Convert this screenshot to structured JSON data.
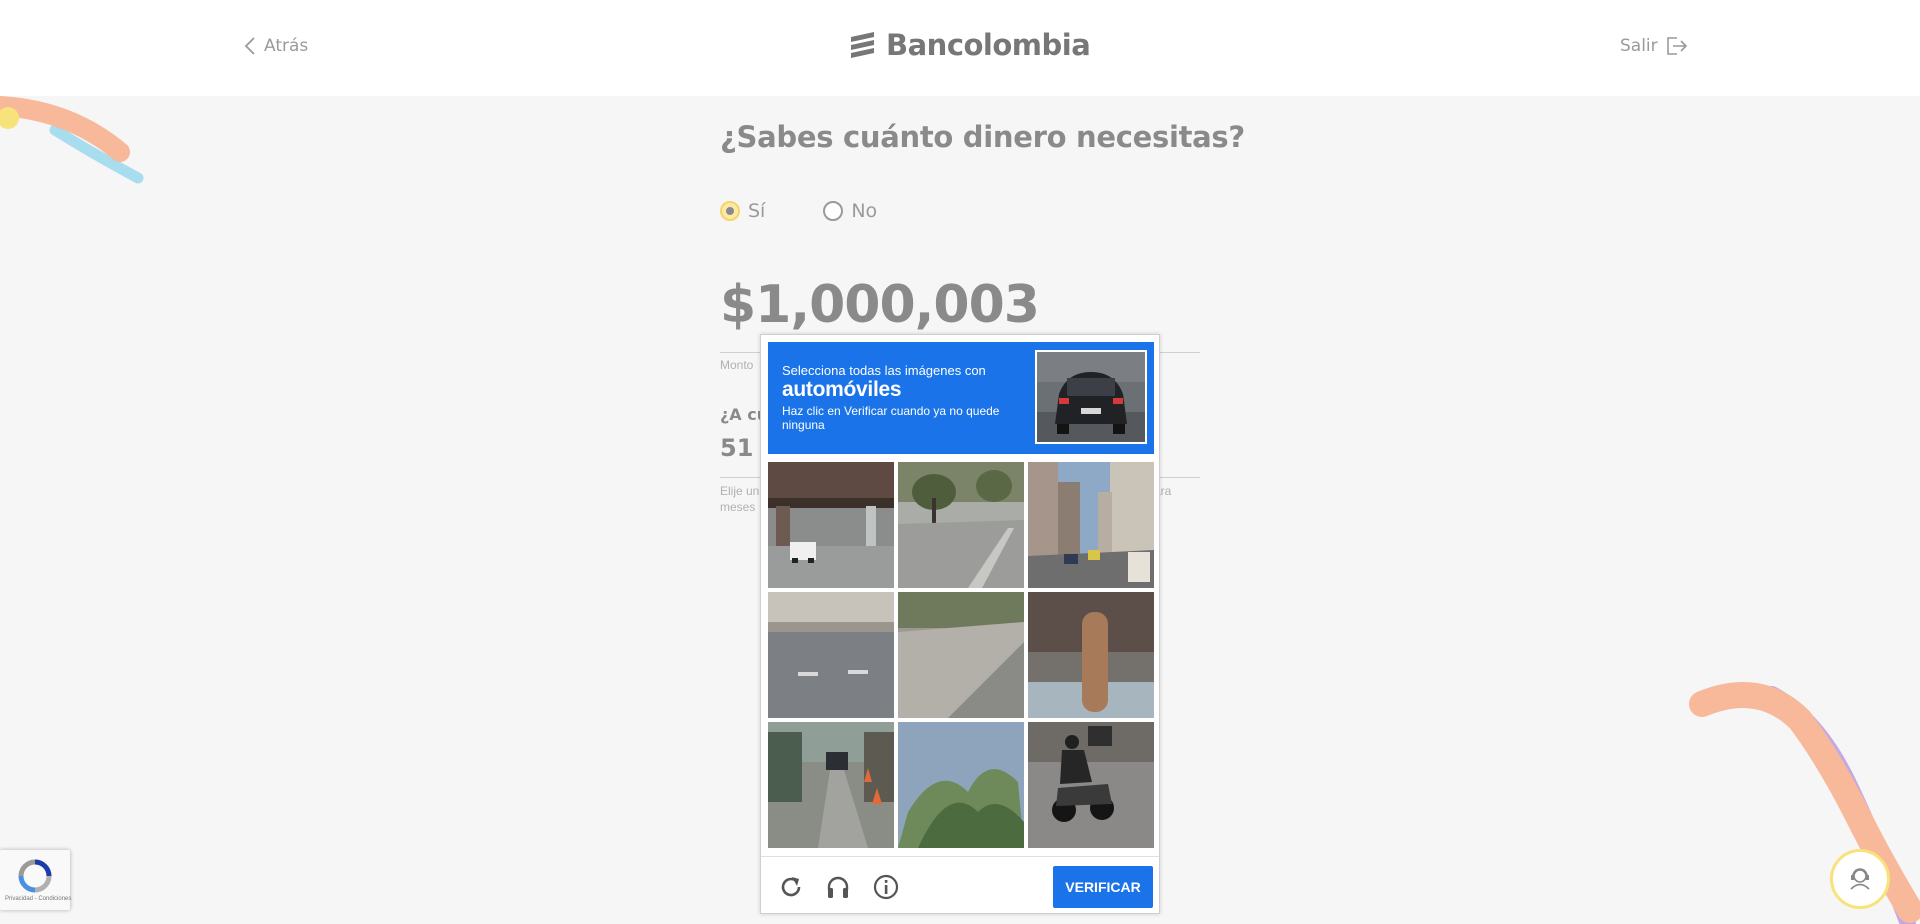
{
  "header": {
    "back_label": "Atrás",
    "brand": "Bancolombia",
    "exit_label": "Salir"
  },
  "form": {
    "question": "¿Sabes cuánto dinero necesitas?",
    "options": [
      {
        "label": "Sí",
        "selected": true
      },
      {
        "label": "No",
        "selected": false
      }
    ],
    "amount": "$1,000,003",
    "amount_caption_visible": "Monto",
    "term_label_visible": "¿A cu",
    "term_value": "51",
    "term_hint_left": "Elije un",
    "term_hint_right": "ara",
    "term_hint_line2": "meses"
  },
  "captcha": {
    "instruction": "Selecciona todas las imágenes con",
    "keyword": "automóviles",
    "subtext": "Haz clic en Verificar cuando ya no quede ninguna",
    "verify_label": "VERIFICAR",
    "tiles": [
      "overpass with car",
      "road and trees",
      "city street with buildings",
      "road with barrier",
      "sidewalk",
      "pole on street",
      "street with car and cones",
      "palm tree",
      "motorcycle on road"
    ]
  },
  "recaptcha_badge": {
    "footer_text": "Privacidad - Condiciones"
  },
  "colors": {
    "accent_blue": "#1a73e8",
    "brand_yellow": "#f8e27a",
    "deco_peach": "#f8b89a",
    "deco_lightblue": "#a8dcef",
    "deco_lavender": "#c4a8e4"
  }
}
